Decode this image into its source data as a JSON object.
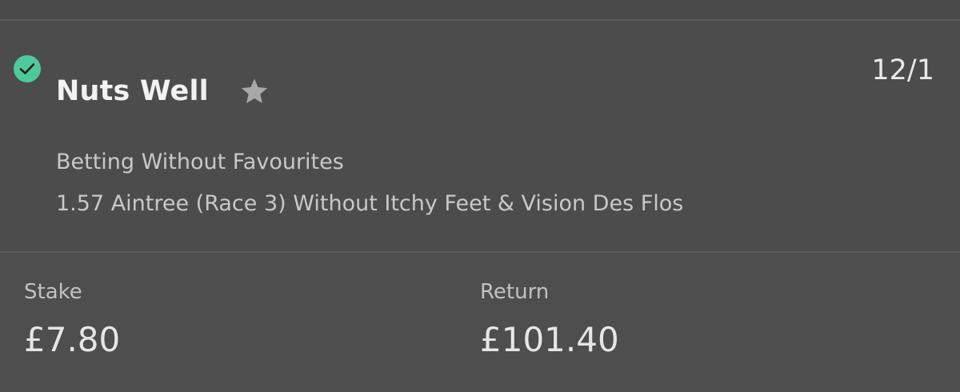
{
  "bet": {
    "status_icon": "check-circle-icon",
    "selection": "Nuts Well",
    "favourite_icon": "star-icon",
    "odds": "12/1",
    "market": "Betting Without Favourites",
    "event": "1.57 Aintree (Race 3) Without Itchy Feet & Vision Des Flos"
  },
  "summary": {
    "stake_label": "Stake",
    "stake_value": "£7.80",
    "return_label": "Return",
    "return_value": "£101.40"
  },
  "colors": {
    "background": "#4b4b4b",
    "status_green": "#4fc99a",
    "star_grey": "#a8a8a8"
  }
}
